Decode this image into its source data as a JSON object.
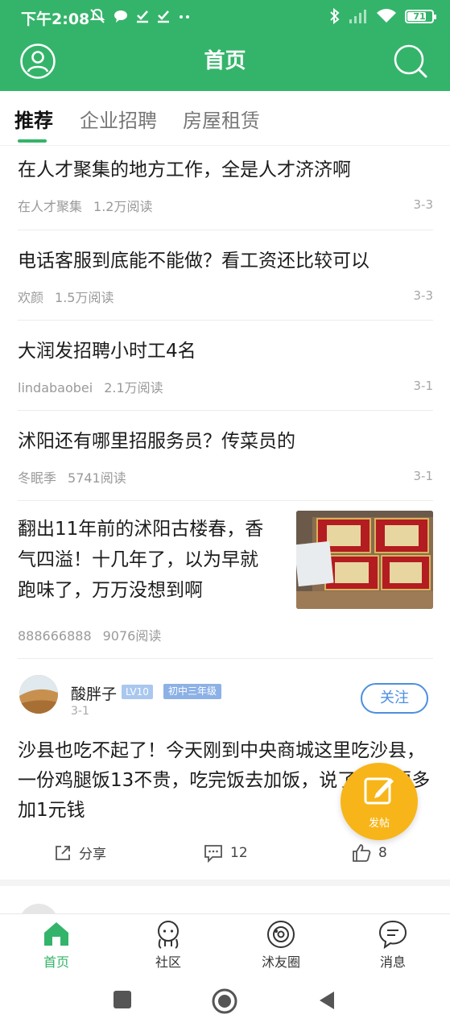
{
  "status_bar": {
    "time": "下午2:08",
    "battery": "71",
    "battery_level_percent": 71
  },
  "header": {
    "title": "首页",
    "user_icon": "user-circle-icon",
    "search_icon": "search-icon"
  },
  "tabs": [
    {
      "label": "推荐",
      "active": true
    },
    {
      "label": "企业招聘",
      "active": false
    },
    {
      "label": "房屋租赁",
      "active": false
    }
  ],
  "feed": [
    {
      "title": "在人才聚集的地方工作，全是人才济济啊",
      "author": "在人才聚集",
      "reads": "1.2万阅读",
      "date": "3-3"
    },
    {
      "title": "电话客服到底能不能做？看工资还比较可以",
      "author": "欢颜",
      "reads": "1.5万阅读",
      "date": "3-3"
    },
    {
      "title": "大润发招聘小时工4名",
      "author": "lindabaobei",
      "reads": "2.1万阅读",
      "date": "3-1"
    },
    {
      "title": "沭阳还有哪里招服务员？传菜员的",
      "author": "冬眠季",
      "reads": "5741阅读",
      "date": "3-1"
    },
    {
      "title": "翻出11年前的沭阳古楼春，香气四溢！十几年了，以为早就跑味了，万万没想到啊",
      "author": "888666888",
      "reads": "9076阅读",
      "date": ""
    }
  ],
  "post": {
    "user": "酸胖子",
    "level": "LV10",
    "grade": "初中三年级",
    "date": "3-1",
    "follow_label": "关注",
    "body": "沙县也吃不起了！今天刚到中央商城这里吃沙县，一份鸡腿饭13不贵，吃完饭去加饭，说了加多要多加1元钱",
    "share_label": "分享",
    "comments": "12",
    "likes": "8"
  },
  "fab": {
    "label": "发帖",
    "icon": "edit-icon"
  },
  "bottom_nav": [
    {
      "label": "首页",
      "icon": "home-icon",
      "active": true
    },
    {
      "label": "社区",
      "icon": "community-icon",
      "active": false
    },
    {
      "label": "沭友圈",
      "icon": "planet-icon",
      "active": false
    },
    {
      "label": "消息",
      "icon": "message-icon",
      "active": false
    }
  ],
  "colors": {
    "brand_green": "#34b46a",
    "follow_blue": "#4d8fe0",
    "fab_yellow": "#f7b519"
  }
}
